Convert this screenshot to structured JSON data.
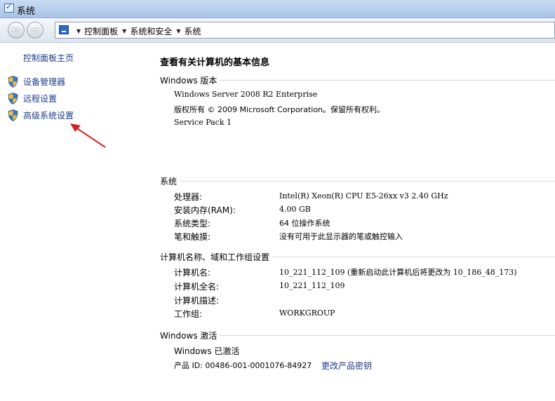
{
  "window": {
    "title": "系统"
  },
  "address": {
    "crumbs": [
      "控制面板",
      "系统和安全",
      "系统"
    ]
  },
  "sidebar": {
    "home": "控制面板主页",
    "tasks": [
      {
        "label": "设备管理器"
      },
      {
        "label": "远程设置"
      },
      {
        "label": "高级系统设置"
      }
    ]
  },
  "main": {
    "heading": "查看有关计算机的基本信息",
    "edition": {
      "title": "Windows 版本",
      "name": "Windows Server 2008 R2 Enterprise",
      "copyright": "版权所有 © 2009 Microsoft Corporation。保留所有权利。",
      "service_pack": "Service Pack 1"
    },
    "system": {
      "title": "系统",
      "rows": [
        {
          "label": "处理器:",
          "value": "Intel(R) Xeon(R) CPU E5-26xx v3   2.40 GHz"
        },
        {
          "label": "安装内存(RAM):",
          "value": "4.00 GB"
        },
        {
          "label": "系统类型:",
          "value": "64 位操作系统"
        },
        {
          "label": "笔和触摸:",
          "value": "没有可用于此显示器的笔或触控输入"
        }
      ]
    },
    "computer": {
      "title": "计算机名称、域和工作组设置",
      "rows": [
        {
          "label": "计算机名:",
          "value": "10_221_112_109  (重新启动此计算机后将更改为 10_186_48_173)"
        },
        {
          "label": "计算机全名:",
          "value": "10_221_112_109"
        },
        {
          "label": "计算机描述:",
          "value": ""
        },
        {
          "label": "工作组:",
          "value": "WORKGROUP"
        }
      ]
    },
    "activation": {
      "title": "Windows 激活",
      "status": "Windows 已激活",
      "product_id": "产品 ID: 00486-001-0001076-84927",
      "change_key": "更改产品密钥"
    }
  }
}
